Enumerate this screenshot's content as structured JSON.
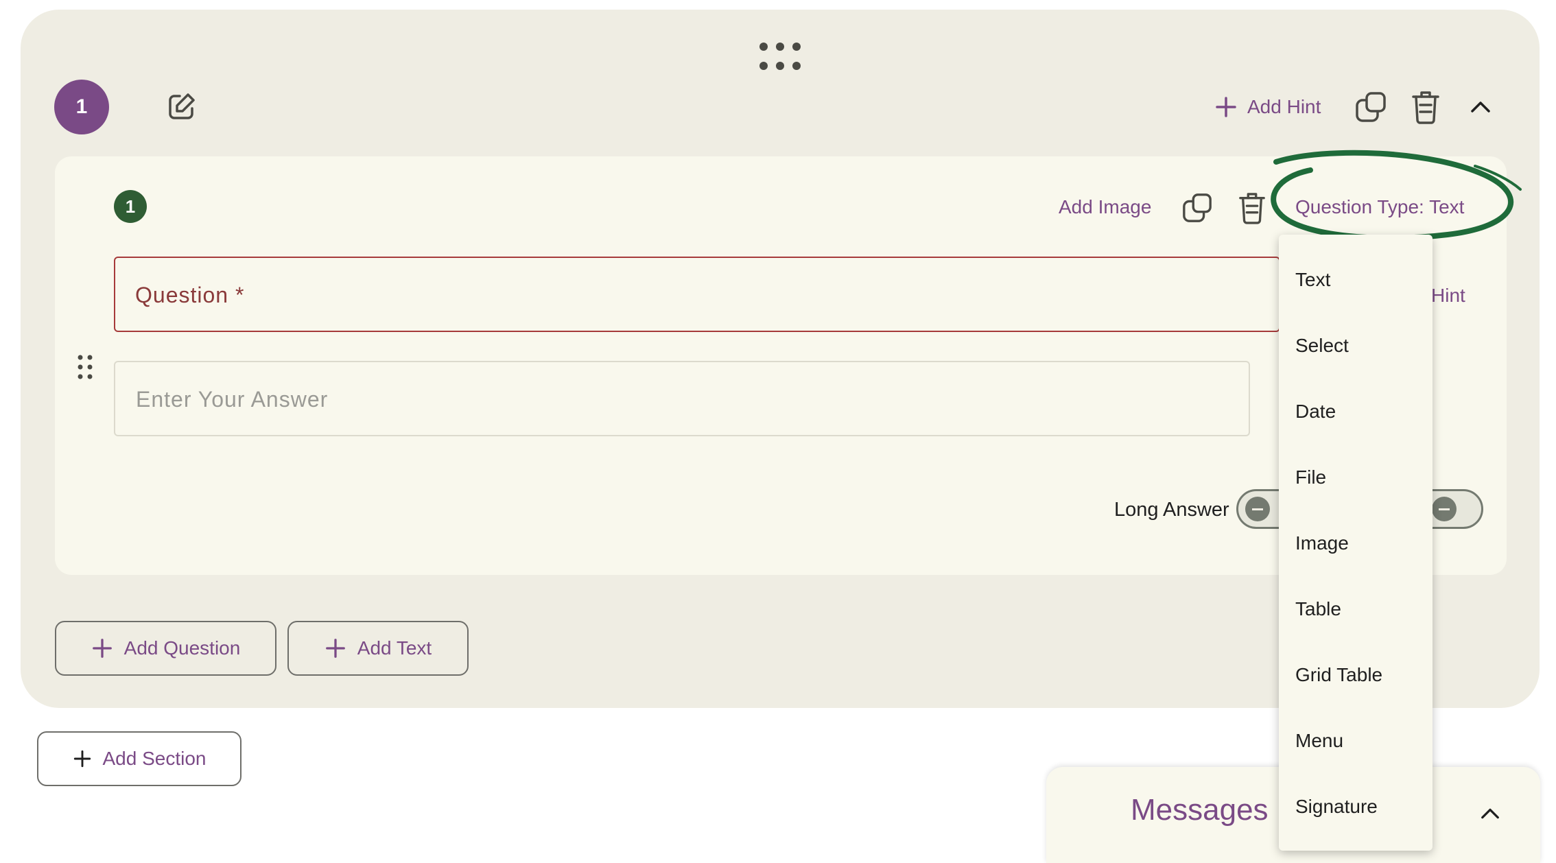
{
  "section": {
    "number": "1",
    "add_hint_label": "Add Hint"
  },
  "question": {
    "number": "1",
    "add_image_label": "Add Image",
    "type_label": "Question Type: Text",
    "question_placeholder": "Question *",
    "answer_placeholder": "Enter Your Answer",
    "hint_label": "Hint",
    "long_answer_label": "Long Answer",
    "long_answer_enabled": false
  },
  "actions": {
    "add_question_label": "Add Question",
    "add_text_label": "Add Text",
    "add_section_label": "Add Section"
  },
  "type_menu": {
    "items": [
      "Text",
      "Select",
      "Date",
      "File",
      "Image",
      "Table",
      "Grid Table",
      "Menu",
      "Signature"
    ]
  },
  "messages": {
    "title": "Messages"
  },
  "colors": {
    "accent": "#7a4a86",
    "question_badge": "#2f5d34",
    "annotation_circle": "#1f6b3a",
    "error_border": "#a63a3a",
    "section_bg": "#efede3",
    "card_bg": "#f9f8ed"
  }
}
